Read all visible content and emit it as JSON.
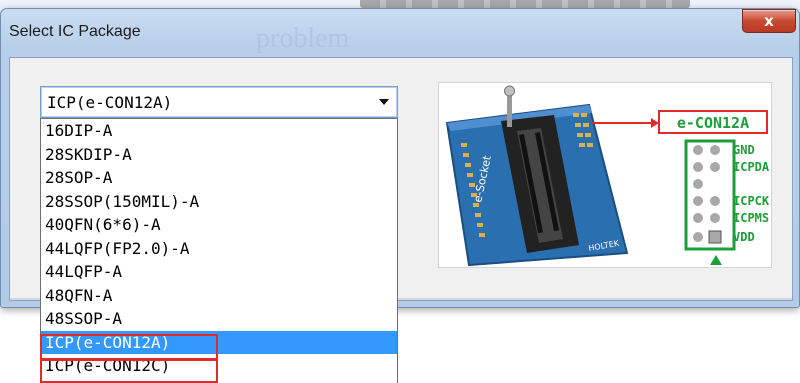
{
  "dialog": {
    "title": "Select IC Package",
    "watermark": "problem",
    "close_label": "x"
  },
  "combo": {
    "selected": "ICP(e-CON12A)"
  },
  "dropdown": {
    "items": [
      "16DIP-A",
      "28SKDIP-A",
      "28SOP-A",
      "28SSOP(150MIL)-A",
      "40QFN(6*6)-A",
      "44LQFP(FP2.0)-A",
      "44LQFP-A",
      "48QFN-A",
      "48SSOP-A",
      "ICP(e-CON12A)",
      "ICP(e-CON12C)"
    ],
    "selected_index": 9
  },
  "package_image": {
    "board_label": "e-Socket",
    "connector_label": "e-CON12A",
    "brand": "HOLTEK",
    "pins": [
      "GND",
      "ICPDA",
      "ICPCK",
      "ICPMS",
      "VDD"
    ]
  },
  "colors": {
    "highlight": "#3399ff",
    "red_outline": "#e22a2a",
    "pin_green": "#1e9e3a",
    "board_blue": "#2a6fb0"
  }
}
